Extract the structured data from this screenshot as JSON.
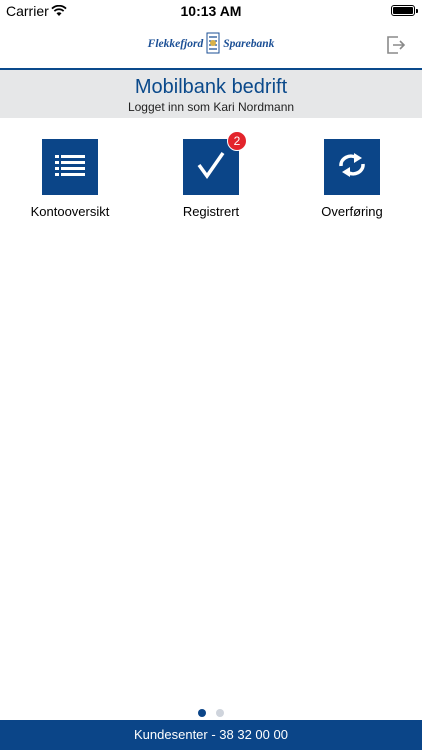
{
  "status": {
    "carrier": "Carrier",
    "time": "10:13 AM"
  },
  "brand": {
    "left": "Flekkefjord",
    "right": "Sparebank"
  },
  "header": {
    "title": "Mobilbank bedrift",
    "subtitle": "Logget inn som Kari Nordmann"
  },
  "tiles": [
    {
      "label": "Kontooversikt",
      "icon": "list-icon"
    },
    {
      "label": "Registrert",
      "icon": "checkmark-icon",
      "badge": "2"
    },
    {
      "label": "Overføring",
      "icon": "transfer-arrows-icon"
    }
  ],
  "pager": {
    "count": 2,
    "active": 1
  },
  "footer": {
    "text": "Kundesenter - 38 32 00 00"
  },
  "colors": {
    "primary": "#0b4588",
    "badge": "#e3242b",
    "header_bg": "#e6e7e8"
  }
}
